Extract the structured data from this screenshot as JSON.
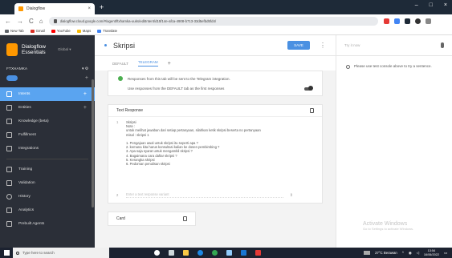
{
  "browser": {
    "tab_title": "Dialogflow",
    "tab_close": "×",
    "new_tab": "+",
    "window_controls": [
      "–",
      "□",
      "×"
    ],
    "nav": [
      "←",
      "→",
      "C",
      "⌂"
    ],
    "url": "dialogflow.cloud.google.com/#/agent/ftxhamka-uuks/editIntent/d15f14e-afca-4908-b713-33d5efbd5fd4/",
    "bookmarks": [
      {
        "label": "New Tab",
        "color": "#5f6368"
      },
      {
        "label": "Gmail",
        "color": "#d93025"
      },
      {
        "label": "YouTube",
        "color": "#ff0000"
      },
      {
        "label": "Maps",
        "color": "#fbbc04"
      },
      {
        "label": "Translate",
        "color": "#4285f4"
      }
    ]
  },
  "sidebar": {
    "brand_line1": "Dialogflow",
    "brand_line2": "Essentials",
    "version": "Global ▾",
    "agent_name": "FTXHAMKA",
    "agent_controls": "▾ ⚙",
    "items": [
      {
        "label": "Intents",
        "icon": "chat-icon"
      },
      {
        "label": "Entities",
        "icon": "entity-icon"
      },
      {
        "label": "Knowledge (beta)",
        "icon": "document-icon"
      },
      {
        "label": "Fulfillment",
        "icon": "bolt-icon"
      },
      {
        "label": "Integrations",
        "icon": "puzzle-icon"
      },
      {
        "label": "Training",
        "icon": "graduation-icon"
      },
      {
        "label": "Validation",
        "icon": "check-icon"
      },
      {
        "label": "History",
        "icon": "history-icon"
      },
      {
        "label": "Analytics",
        "icon": "chart-icon"
      },
      {
        "label": "Prebuilt Agents",
        "icon": "agent-icon"
      }
    ]
  },
  "intent": {
    "name": "Skripsi",
    "save_label": "SAVE",
    "tabs": [
      "DEFAULT",
      "TELEGRAM"
    ],
    "add_tab": "+",
    "telegram_notice": "Responses from this tab will be sent to the Telegram integration.",
    "use_default": "Use responses from the DEFAULT tab as the first responses",
    "text_response_title": "Text Response",
    "response_1": "Skripsi\nNote :\nuntuk melihat jawaban dari setiap pertanyaan, silahkan ketik skripsi beserta no pertanyaan\nmisal : skripsi 1\n\n1. Pengajuan awal untuk skripsi itu seperti apa ?\n2. kemana kita harus konsultasi kalian ke dosen pembimbing ?\n3. Apa saja syarat untuk mengambil skripsi ?\n4. Bagaimana cara daftar skripsi ?\n5. Kerangka skripsi\n6. Pedoman penulisan skripsi",
    "line1": "1",
    "line2": "2",
    "response_placeholder": "Enter a text response variant",
    "card_title": "Card"
  },
  "right": {
    "try_placeholder": "Try it now",
    "hint": "Please use test console above to try a sentence."
  },
  "watermark": {
    "title": "Activate Windows",
    "subtitle": "Go to Settings to activate Windows."
  },
  "taskbar": {
    "search_placeholder": "Type here to search",
    "apps": [
      {
        "name": "cortana",
        "color": "#ffffff"
      },
      {
        "name": "task-view",
        "color": "#cfd8dc"
      },
      {
        "name": "file-explorer",
        "color": "#f9c846"
      },
      {
        "name": "edge",
        "color": "#1e88e5"
      },
      {
        "name": "chrome",
        "color": "#34a853"
      },
      {
        "name": "store",
        "color": "#90caf9"
      },
      {
        "name": "mail",
        "color": "#1976d2"
      },
      {
        "name": "app",
        "color": "#e53935"
      }
    ],
    "weather": "27°C Berawan",
    "time": "13:54",
    "date": "16/06/2022"
  }
}
